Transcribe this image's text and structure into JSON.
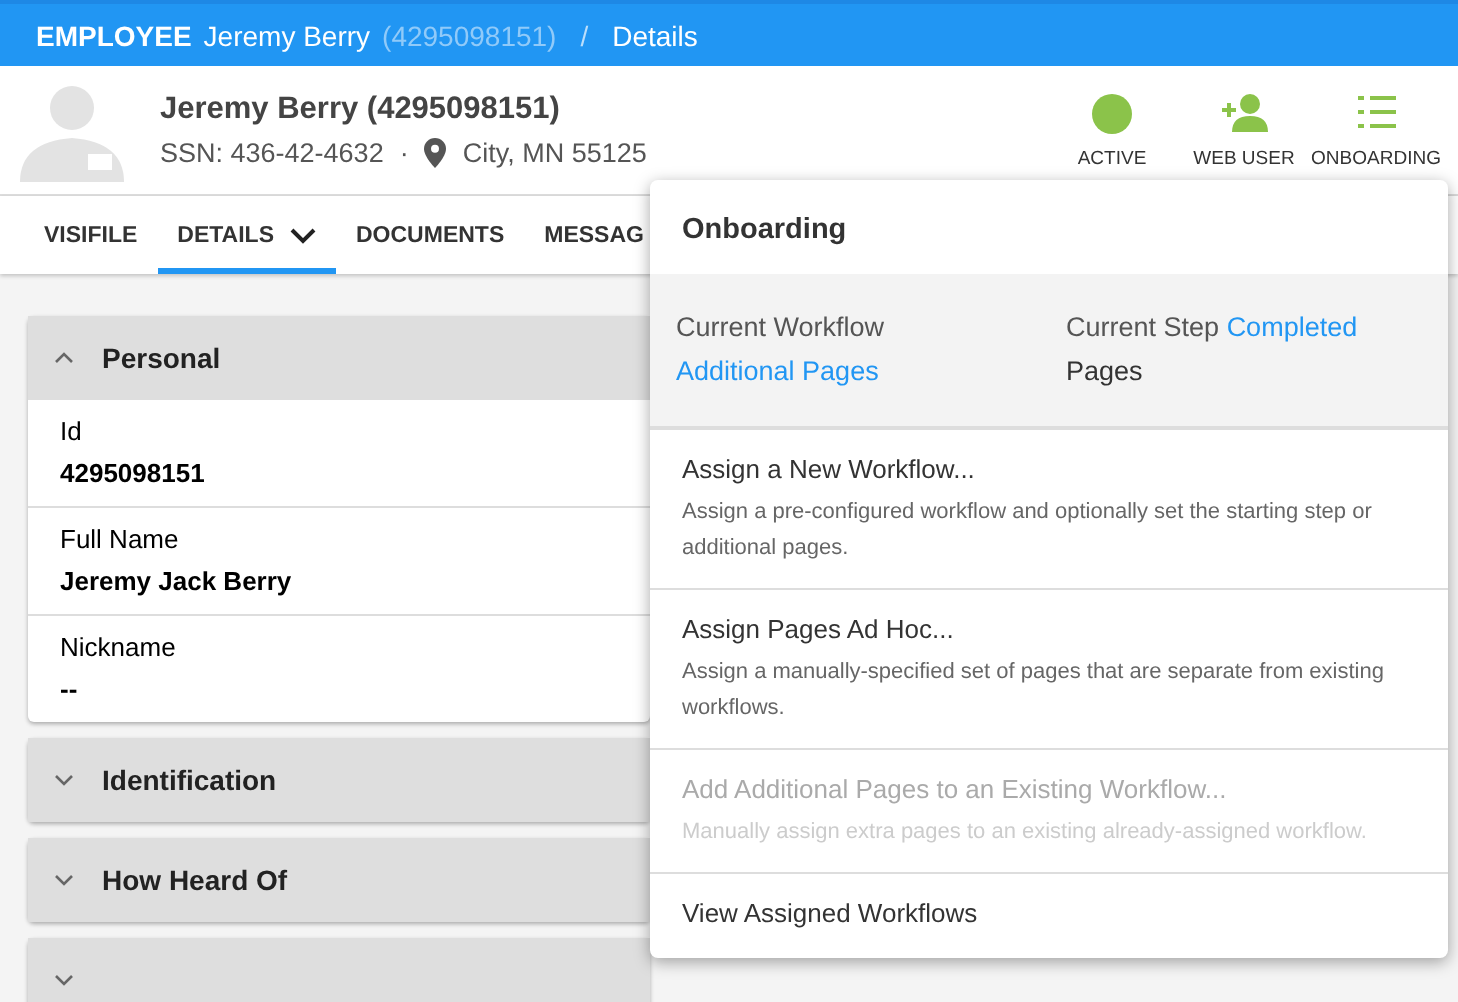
{
  "header": {
    "section": "EMPLOYEE",
    "name": "Jeremy Berry",
    "id": "(4295098151)",
    "separator": "/",
    "page": "Details"
  },
  "profile": {
    "name": "Jeremy Berry (4295098151)",
    "ssn": "SSN: 436-42-4632",
    "dot": "·",
    "location": "City, MN 55125"
  },
  "statuses": [
    {
      "kind": "active",
      "label": "ACTIVE"
    },
    {
      "kind": "web-user",
      "label": "WEB USER"
    },
    {
      "kind": "onboarding",
      "label": "ONBOARDING"
    }
  ],
  "tabs": [
    {
      "label": "VISIFILE",
      "selected": false
    },
    {
      "label": "DETAILS",
      "selected": true,
      "dropdown": true
    },
    {
      "label": "DOCUMENTS",
      "selected": false
    },
    {
      "label": "MESSAG",
      "selected": false
    }
  ],
  "panels": [
    {
      "title": "Personal",
      "expanded": true,
      "fields": [
        {
          "label": "Id",
          "value": "4295098151"
        },
        {
          "label": "Full Name",
          "value": "Jeremy Jack Berry"
        },
        {
          "label": "Nickname",
          "value": "--"
        }
      ]
    },
    {
      "title": "Identification",
      "expanded": false
    },
    {
      "title": "How Heard Of",
      "expanded": false
    },
    {
      "expanded": false
    }
  ],
  "menu": {
    "title": "Onboarding",
    "workflow": {
      "label": "Current Workflow",
      "value": "Additional Pages"
    },
    "step": {
      "label": "Current Step",
      "value": "Completed",
      "note": "Pages"
    },
    "items": [
      {
        "title": "Assign a New Workflow...",
        "description": "Assign a pre-configured workflow and optionally set the starting step or additional pages.",
        "disabled": false
      },
      {
        "title": "Assign Pages Ad Hoc...",
        "description": "Assign a manually-specified set of pages that are separate from existing workflows.",
        "disabled": false
      },
      {
        "title": "Add Additional Pages to an Existing Workflow...",
        "description": "Manually assign extra pages to an existing already-assigned workflow.",
        "disabled": true
      },
      {
        "title": "View Assigned Workflows",
        "disabled": false
      }
    ]
  }
}
